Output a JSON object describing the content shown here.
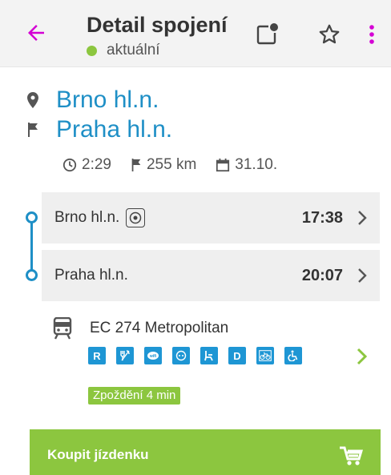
{
  "header": {
    "title": "Detail spojení",
    "status": "aktuální"
  },
  "route": {
    "from": "Brno hl.n.",
    "to": "Praha hl.n.",
    "duration": "2:29",
    "distance": "255 km",
    "date": "31.10."
  },
  "stops": [
    {
      "name": "Brno hl.n.",
      "time": "17:38"
    },
    {
      "name": "Praha hl.n.",
      "time": "20:07"
    }
  ],
  "train": {
    "name": "EC 274 Metropolitan",
    "amenities": [
      "R",
      "restaurant-icon",
      "wifi-icon",
      "socket-icon",
      "seat-icon",
      "D",
      "bicycle-icon",
      "wheelchair-icon"
    ],
    "delay": "Zpoždění 4 min"
  },
  "buy": {
    "label": "Koupit jízdenku"
  },
  "colors": {
    "accent_purple": "#d400d4",
    "link_blue": "#1e8fc6",
    "green": "#8cc63f",
    "amenity_blue": "#1e96d4"
  }
}
